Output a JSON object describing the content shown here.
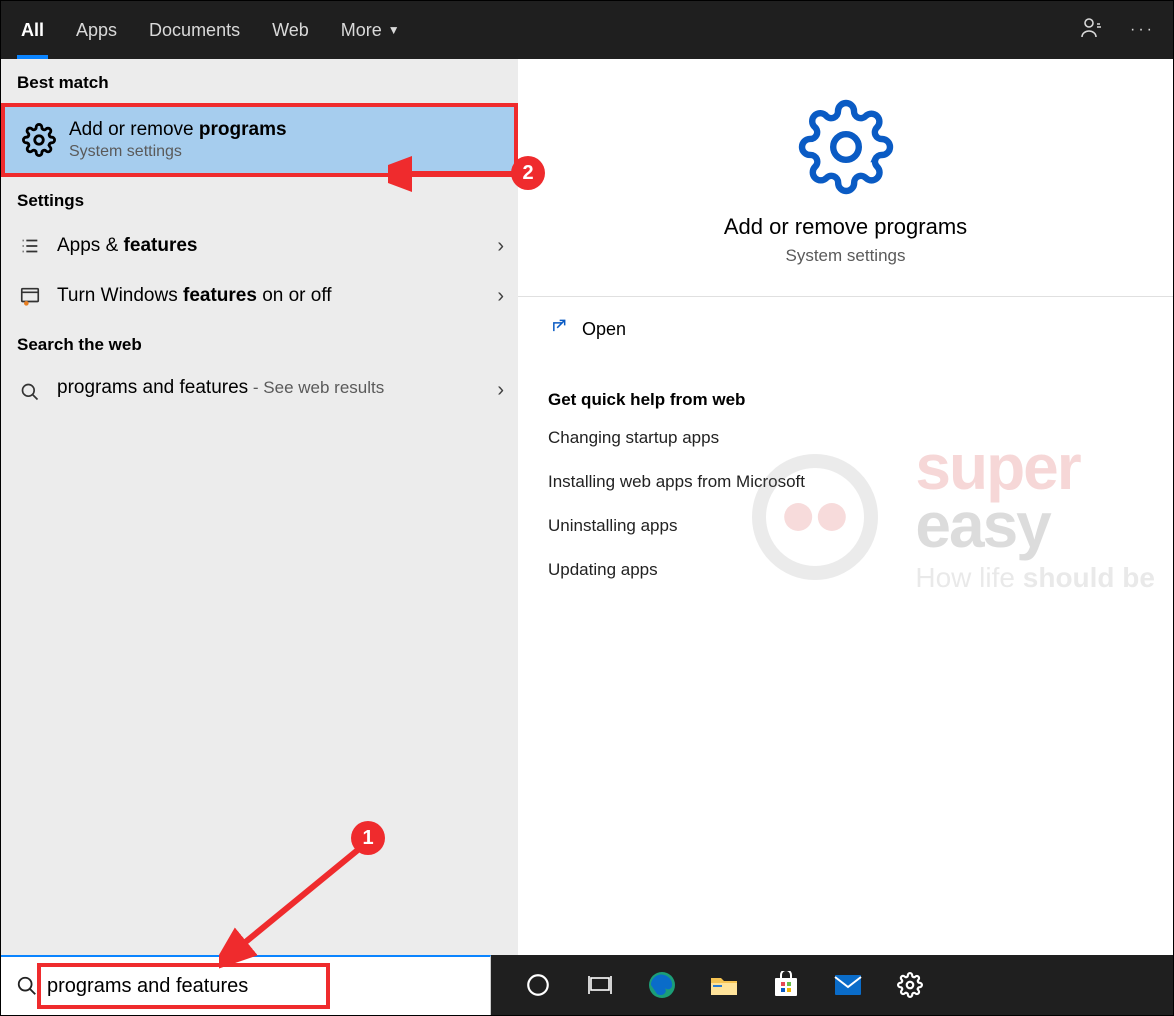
{
  "tabs": {
    "all": "All",
    "apps": "Apps",
    "documents": "Documents",
    "web": "Web",
    "more": "More"
  },
  "left": {
    "best_match_label": "Best match",
    "best_match": {
      "title_pre": "Add or remove ",
      "title_bold": "programs",
      "subtitle": "System settings"
    },
    "settings_label": "Settings",
    "settings_items": [
      {
        "pre": "Apps & ",
        "bold": "features"
      },
      {
        "pre": "Turn Windows ",
        "bold": "features",
        "post": " on or off"
      }
    ],
    "search_web_label": "Search the web",
    "web_item": {
      "pre": "programs and features",
      "post": " - See web results"
    }
  },
  "right": {
    "hero": {
      "title": "Add or remove programs",
      "subtitle": "System settings"
    },
    "open_label": "Open",
    "quick_help_header": "Get quick help from web",
    "quick_help_links": [
      "Changing startup apps",
      "Installing web apps from Microsoft",
      "Uninstalling apps",
      "Updating apps"
    ]
  },
  "search": {
    "value": "programs and features"
  },
  "annotations": {
    "step1": "1",
    "step2": "2"
  },
  "watermark": {
    "line1": "super",
    "line2": "easy",
    "tag_pre": "How life ",
    "tag_bold": "should be"
  }
}
